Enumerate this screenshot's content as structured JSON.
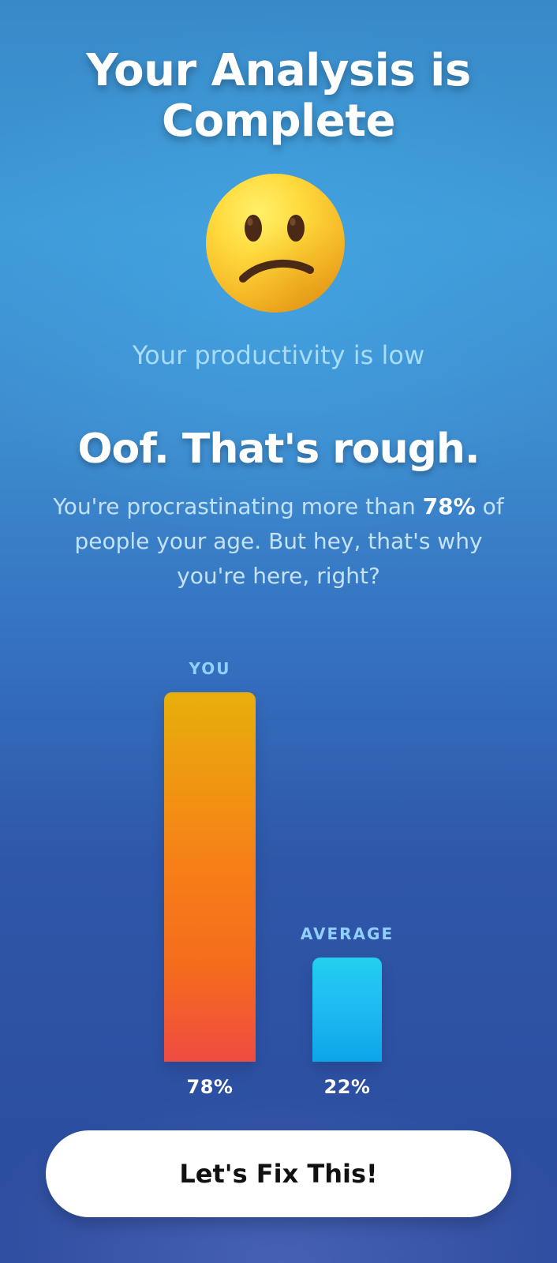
{
  "screen": {
    "title": "Your Analysis is Complete",
    "emoji_icon": "confused-face-icon",
    "status": "Your productivity is low",
    "headline": "Oof. That's rough.",
    "description": {
      "part1": "You're procrastinating more than ",
      "highlight": "78%",
      "part2": " of people your age. But hey, that's why you're here, right?"
    },
    "button_label": "Let's Fix This!"
  },
  "colors": {
    "background_top": "#3889c8",
    "background_bottom": "#2b4a9d",
    "status_text": "#a9dcf7",
    "chart_label": "#8fd0ff",
    "you_bar_top": "#e8af0b",
    "you_bar_bottom": "#ef4b42",
    "average_bar_top": "#23cfee",
    "average_bar_bottom": "#0ca5e8",
    "button_bg": "#ffffff"
  },
  "chart_data": {
    "type": "bar",
    "categories": [
      "YOU",
      "AVERAGE"
    ],
    "values": [
      78,
      22
    ],
    "value_labels": [
      "78%",
      "22%"
    ],
    "ylim": [
      0,
      100
    ],
    "grid": false
  }
}
